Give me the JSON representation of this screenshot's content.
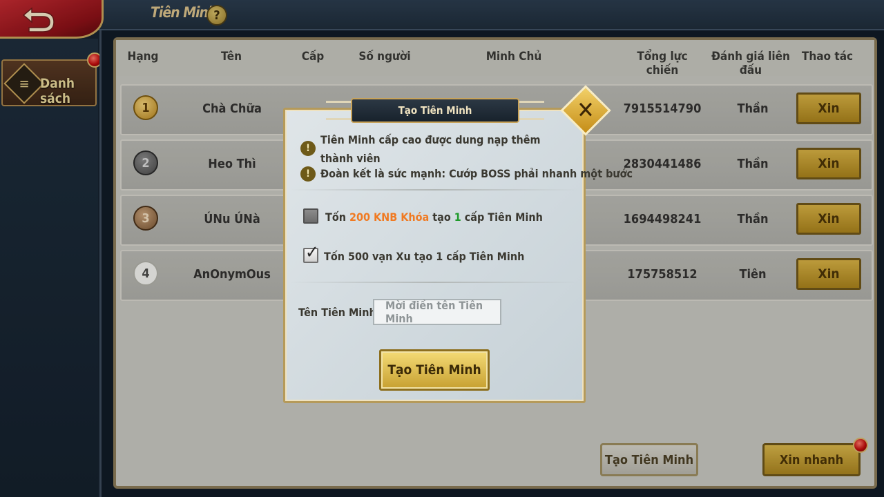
{
  "topbar": {
    "title": "Tiên Minh",
    "help": "?"
  },
  "sidebar": {
    "tab_label": "Danh sách"
  },
  "table": {
    "headers": [
      "Hạng",
      "Tên",
      "Cấp",
      "Số người",
      "Minh Chủ",
      "Tổng lực chiến",
      "Đánh giá liên đấu",
      "Thao tác"
    ],
    "rows": [
      {
        "rank": "1",
        "name": "Chà Chữa",
        "power": "7915514790",
        "rating": "Thần",
        "action": "Xin"
      },
      {
        "rank": "2",
        "name": "Heo Thì",
        "power": "2830441486",
        "rating": "Thần",
        "action": "Xin"
      },
      {
        "rank": "3",
        "name": "ÚNu ÚNà",
        "power": "1694498241",
        "rating": "Thần",
        "action": "Xin"
      },
      {
        "rank": "4",
        "name": "AnOnymOus",
        "power": "175758512",
        "rating": "Tiên",
        "action": "Xin"
      }
    ]
  },
  "footer": {
    "create_label": "Tạo Tiên Minh",
    "quick_label": "Xin nhanh"
  },
  "modal": {
    "title": "Tạo Tiên Minh",
    "close": "✕",
    "note1_line1": "Tiên Minh cấp cao được dung nạp thêm",
    "note1_line2": "thành viên",
    "note2": "Đoàn kết là sức mạnh: Cướp BOSS phải nhanh một bước",
    "option1": {
      "prefix": "Tốn ",
      "amount": "200 KNB Khóa",
      "mid": " tạo ",
      "level": "1",
      "suffix": " cấp Tiên Minh",
      "checked": false
    },
    "option2": {
      "label": "Tốn 500 vạn Xu tạo 1 cấp Tiên Minh",
      "checked": true
    },
    "name_label": "Tên Tiên Minh:",
    "name_placeholder": "Mời điền tên Tiên Minh",
    "submit_label": "Tạo Tiên Minh"
  },
  "colors": {
    "accent_gold": "#c8a35a",
    "amount_orange": "#f07a22",
    "level_green": "#1f9a2a",
    "back_red": "#c22a31"
  }
}
